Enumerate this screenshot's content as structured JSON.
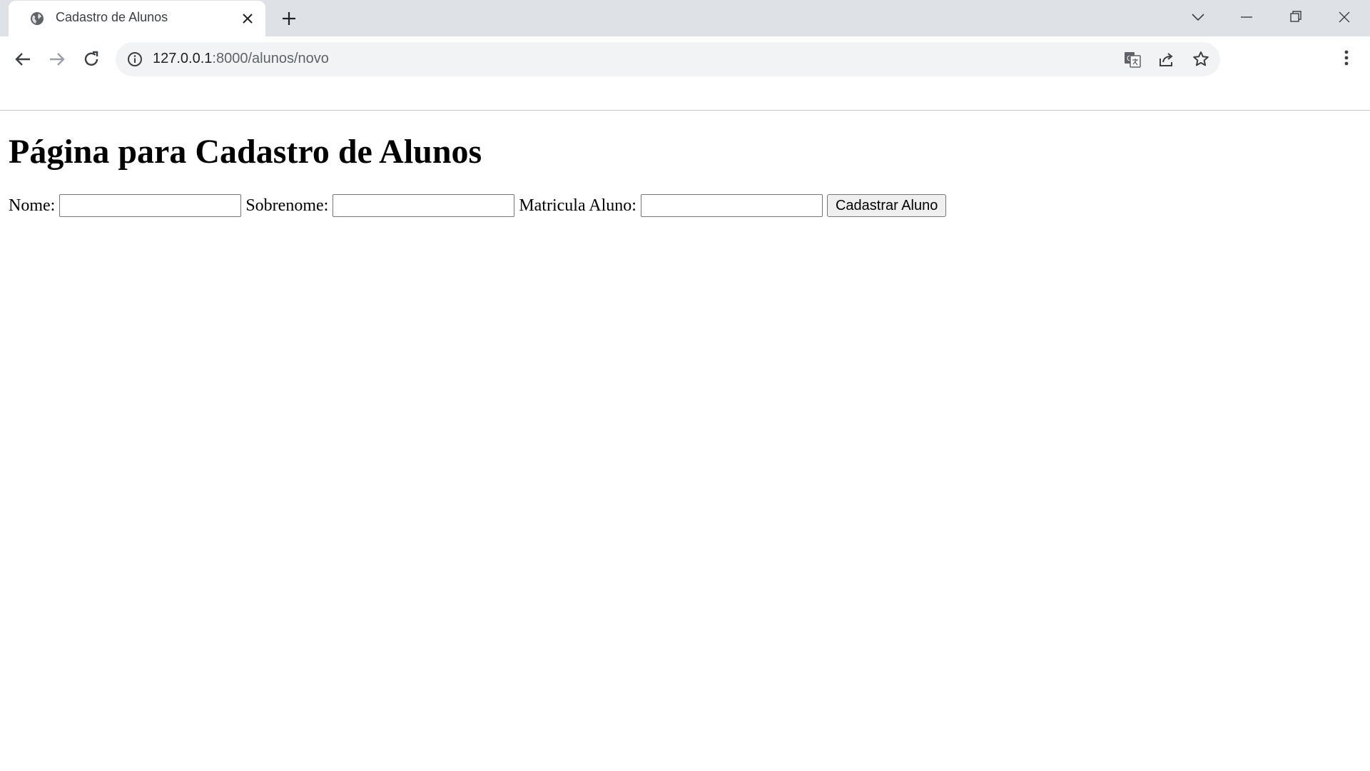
{
  "browser": {
    "tab": {
      "title": "Cadastro de Alunos",
      "favicon": "globe-icon",
      "close_icon": "close-icon"
    },
    "new_tab_icon": "plus-icon",
    "window_controls": [
      "tab-search-icon",
      "minimize-icon",
      "restore-icon",
      "close-icon"
    ],
    "address_bar": {
      "url_host": "127.0.0.1",
      "url_path": ":8000/alunos/novo",
      "info_icon": "info-icon",
      "actions": [
        "translate-icon",
        "share-icon",
        "bookmark-star-icon"
      ]
    },
    "nav": [
      "back-arrow-icon",
      "forward-arrow-icon",
      "reload-icon"
    ],
    "menu_icon": "more-vertical-icon"
  },
  "page": {
    "heading": "Página para Cadastro de Alunos",
    "form": {
      "nome_label": "Nome:",
      "nome_value": "",
      "sobrenome_label": "Sobrenome:",
      "sobrenome_value": "",
      "matricula_label": "Matricula Aluno:",
      "matricula_value": "",
      "submit_label": "Cadastrar Aluno"
    }
  }
}
